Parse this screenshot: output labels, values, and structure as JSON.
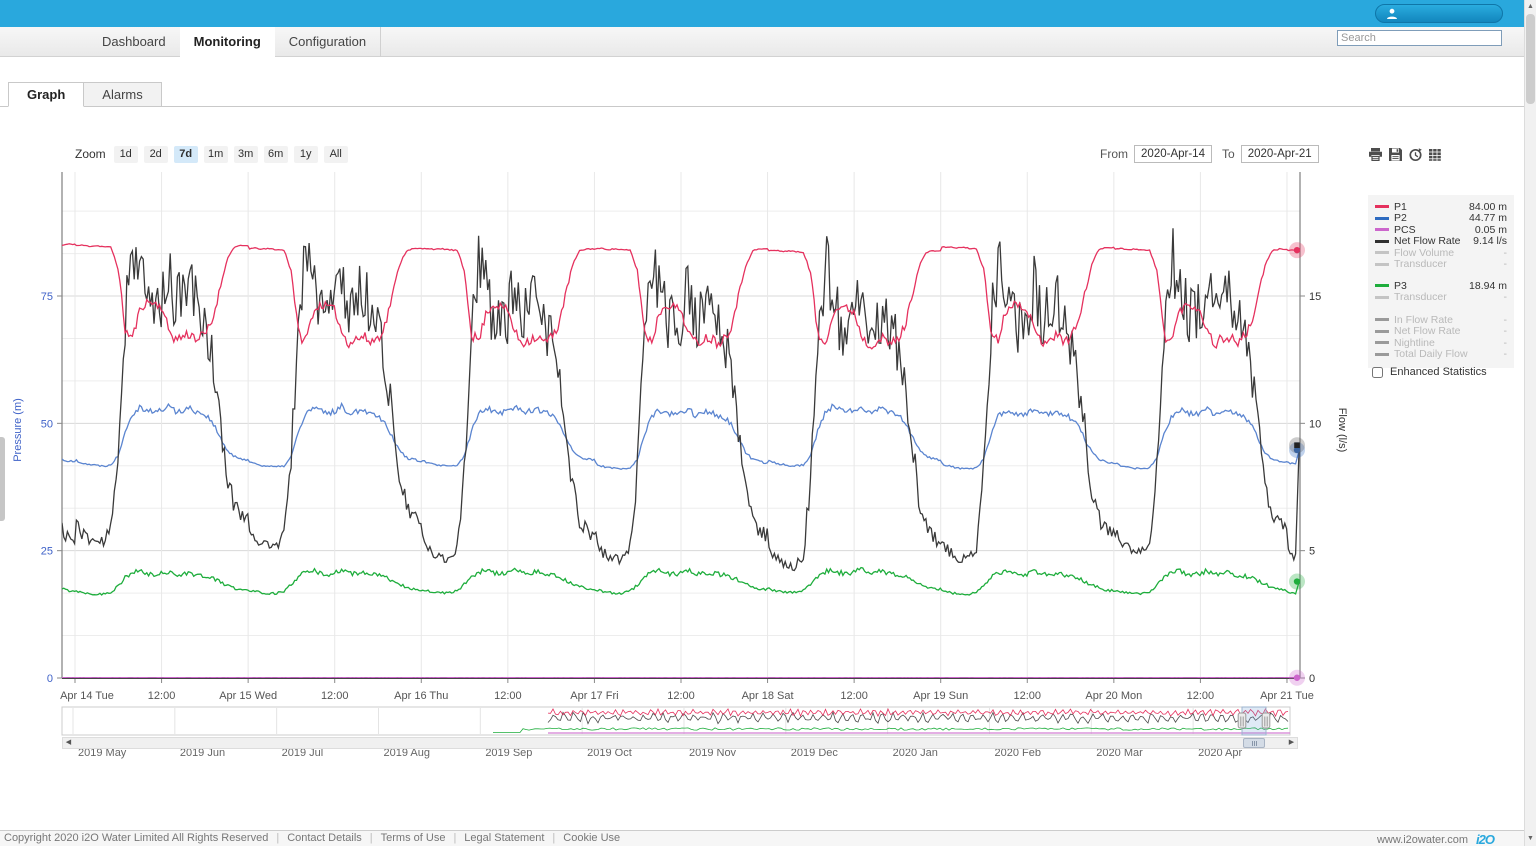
{
  "app": {
    "brand_color": "#29a8dd"
  },
  "nav": {
    "items": [
      {
        "label": "Dashboard",
        "active": false
      },
      {
        "label": "Monitoring",
        "active": true
      },
      {
        "label": "Configuration",
        "active": false
      }
    ],
    "search_placeholder": "Search"
  },
  "subtabs": [
    {
      "label": "Graph",
      "active": true
    },
    {
      "label": "Alarms",
      "active": false
    }
  ],
  "toolbar": {
    "zoom_label": "Zoom",
    "zoom_buttons": [
      "1d",
      "2d",
      "7d",
      "1m",
      "3m",
      "6m",
      "1y",
      "All"
    ],
    "zoom_active": "7d",
    "from_label": "From",
    "from_value": "2020-Apr-14",
    "to_label": "To",
    "to_value": "2020-Apr-21",
    "icons": [
      "print-icon",
      "save-icon",
      "history-icon",
      "table-icon"
    ]
  },
  "legend": {
    "groups": [
      [
        {
          "name": "P1",
          "value": "84.00 m",
          "color": "#e5315e",
          "disabled": false
        },
        {
          "name": "P2",
          "value": "44.77 m",
          "color": "#2e6bc0",
          "disabled": false
        },
        {
          "name": "PCS",
          "value": "0.05 m",
          "color": "#cc66cc",
          "disabled": false
        },
        {
          "name": "Net Flow Rate",
          "value": "9.14 l/s",
          "color": "#303030",
          "disabled": false
        },
        {
          "name": "Flow Volume",
          "value": "-",
          "color": "#c4c4c4",
          "disabled": true
        },
        {
          "name": "Transducer",
          "value": "-",
          "color": "#c4c4c4",
          "disabled": true
        }
      ],
      [
        {
          "name": "P3",
          "value": "18.94 m",
          "color": "#1ead3c",
          "disabled": false
        },
        {
          "name": "Transducer",
          "value": "-",
          "color": "#c4c4c4",
          "disabled": true
        }
      ],
      [
        {
          "name": "In Flow Rate",
          "value": "-",
          "color": "#9a9a9a",
          "disabled": true
        },
        {
          "name": "Net Flow Rate",
          "value": "-",
          "color": "#9a9a9a",
          "disabled": true
        },
        {
          "name": "Nightline",
          "value": "-",
          "color": "#9a9a9a",
          "disabled": true
        },
        {
          "name": "Total Daily Flow",
          "value": "-",
          "color": "#9a9a9a",
          "disabled": true
        }
      ]
    ],
    "enhanced_label": "Enhanced Statistics"
  },
  "chart_data": {
    "type": "line",
    "x_axis": {
      "labels": [
        "Apr 14 Tue",
        "12:00",
        "Apr 15 Wed",
        "12:00",
        "Apr 16 Thu",
        "12:00",
        "Apr 17 Fri",
        "12:00",
        "Apr 18 Sat",
        "12:00",
        "Apr 19 Sun",
        "12:00",
        "Apr 20 Mon",
        "12:00",
        "Apr 21 Tue"
      ],
      "range_days": 7
    },
    "y_axis_left": {
      "title": "Pressure (m)",
      "ticks": [
        0,
        25,
        50,
        75
      ],
      "color": "#3f62c8",
      "unit": "m"
    },
    "y_axis_right": {
      "title": "Flow (l/s)",
      "ticks": [
        0,
        5,
        10,
        15
      ],
      "color": "#333333",
      "unit": "l/s"
    },
    "series": [
      {
        "name": "PCS",
        "axis": "pressure",
        "color": "#cc66cc",
        "current": 0.05,
        "unit": "m",
        "seed": 33,
        "day_profile": [
          0.05,
          0.05,
          0.05,
          0.05,
          0.05,
          0.05,
          0.05,
          0.05,
          0.05,
          0.05,
          0.05,
          0.05,
          0.05,
          0.05,
          0.05,
          0.05,
          0.05,
          0.05,
          0.05,
          0.05,
          0.05,
          0.05,
          0.05,
          0.05
        ],
        "jbase": 0.01,
        "jscale": 0,
        "day_var": 0
      },
      {
        "name": "P3",
        "axis": "pressure",
        "color": "#1ead3c",
        "current": 18.94,
        "unit": "m",
        "seed": 55,
        "day_profile": [
          17.2,
          16.9,
          16.6,
          16.5,
          16.5,
          16.9,
          18.2,
          19.8,
          20.6,
          21.0,
          20.4,
          20.2,
          20.5,
          21.0,
          20.3,
          20.5,
          20.6,
          20.2,
          20.0,
          19.6,
          19.0,
          18.3,
          17.7,
          17.3
        ],
        "jbase": 0.22,
        "jscale": 0.3,
        "day_var": 0.35
      },
      {
        "name": "P2",
        "axis": "pressure",
        "color": "#5b85d0",
        "current": 44.77,
        "unit": "m",
        "seed": 22,
        "day_profile": [
          42.6,
          42.0,
          41.7,
          41.5,
          41.4,
          41.6,
          43.5,
          48.5,
          51.8,
          53.0,
          52.4,
          52.0,
          52.3,
          53.3,
          52.0,
          52.4,
          52.7,
          52.0,
          51.5,
          50.2,
          47.2,
          44.6,
          43.2,
          42.8
        ],
        "jbase": 0.18,
        "jscale": 0.45,
        "day_var": 0.4
      },
      {
        "name": "Net Flow Rate",
        "axis": "flow",
        "color": "#3a3a3a",
        "current": 9.14,
        "unit": "l/s",
        "seed": 44,
        "day_profile": [
          5.8,
          5.2,
          5.0,
          4.9,
          4.9,
          5.4,
          8.5,
          14.0,
          16.8,
          15.3,
          14.4,
          14.0,
          14.4,
          15.6,
          14.1,
          14.6,
          15.0,
          14.2,
          13.6,
          12.2,
          9.8,
          7.6,
          6.4,
          6.0
        ],
        "jbase": 0.2,
        "jscale": 1.25,
        "day_var": 0.5
      },
      {
        "name": "P1",
        "axis": "pressure",
        "color": "#e5315e",
        "current": 84.0,
        "unit": "m",
        "seed": 11,
        "day_profile": [
          84.5,
          84.6,
          84.4,
          84.5,
          84.3,
          84.2,
          80.0,
          67.5,
          66.5,
          72.0,
          73.5,
          73.2,
          72.5,
          68.0,
          66.0,
          66.8,
          67.2,
          66.2,
          67.0,
          69.5,
          75.5,
          81.5,
          84.2,
          84.5
        ],
        "jbase": 1.15,
        "jscale": -1.05,
        "day_var": 1.0
      }
    ]
  },
  "navigator": {
    "months": [
      "2019 May",
      "2019 Jun",
      "2019 Jul",
      "2019 Aug",
      "2019 Sep",
      "2019 Oct",
      "2019 Nov",
      "2019 Dec",
      "2020 Jan",
      "2020 Feb",
      "2020 Mar",
      "2020 Apr"
    ]
  },
  "footer": {
    "copyright": "Copyright 2020 i2O Water Limited All Rights Reserved",
    "links": [
      "Contact Details",
      "Terms of Use",
      "Legal Statement",
      "Cookie Use"
    ],
    "site": "www.i2owater.com",
    "logo": "i2O"
  }
}
